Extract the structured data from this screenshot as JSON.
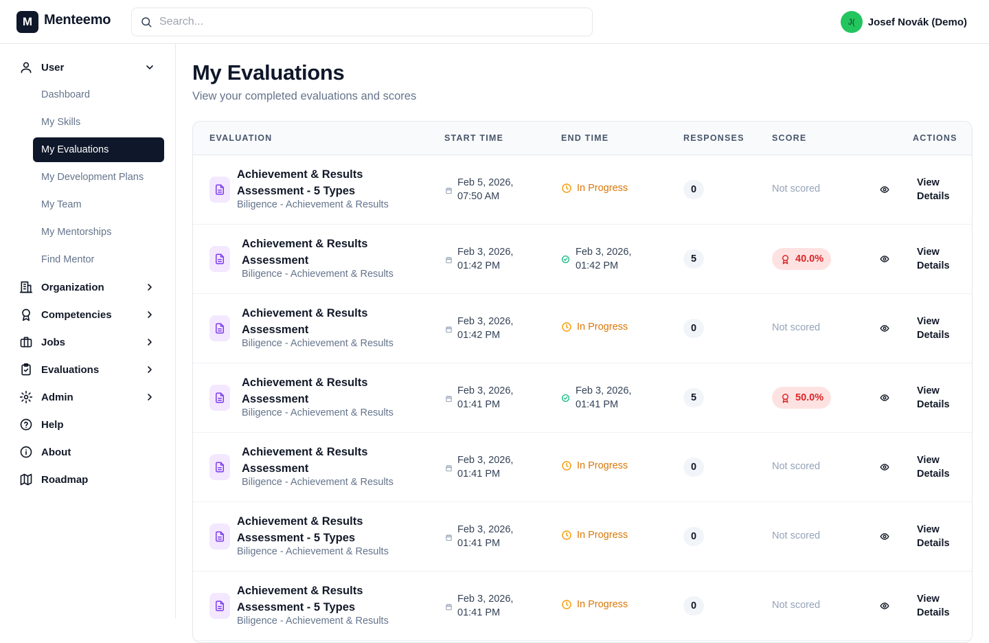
{
  "app": {
    "logo_letter": "M",
    "name": "Menteemo"
  },
  "search": {
    "placeholder": "Search..."
  },
  "user": {
    "initials": "J(",
    "name": "Josef Novák (Demo)"
  },
  "sidebar": {
    "user_group": "User",
    "user_items": [
      "Dashboard",
      "My Skills",
      "My Evaluations",
      "My Development Plans",
      "My Team",
      "My Mentorships",
      "Find Mentor"
    ],
    "active_item": "My Evaluations",
    "groups": [
      "Organization",
      "Competencies",
      "Jobs",
      "Evaluations",
      "Admin",
      "Help",
      "About",
      "Roadmap"
    ]
  },
  "page": {
    "title": "My Evaluations",
    "subtitle": "View your completed evaluations and scores"
  },
  "table": {
    "columns": [
      "EVALUATION",
      "START TIME",
      "END TIME",
      "RESPONSES",
      "SCORE",
      "ACTIONS"
    ],
    "in_progress_label": "In Progress",
    "not_scored_label": "Not scored",
    "action_label_1": "View",
    "action_label_2": "Details",
    "rows": [
      {
        "title_1": "Achievement & Results",
        "title_2": "Assessment - 5 Types",
        "subtitle": "Biligence - Achievement & Results",
        "start_1": "Feb 5, 2026,",
        "start_2": "07:50 AM",
        "end_1": "",
        "end_2": "",
        "responses": "0",
        "score": ""
      },
      {
        "title_1": "Achievement & Results",
        "title_2": "Assessment",
        "subtitle": "Biligence - Achievement & Results",
        "start_1": "Feb 3, 2026,",
        "start_2": "01:42 PM",
        "end_1": "Feb 3, 2026,",
        "end_2": "01:42 PM",
        "responses": "5",
        "score": "40.0%"
      },
      {
        "title_1": "Achievement & Results",
        "title_2": "Assessment",
        "subtitle": "Biligence - Achievement & Results",
        "start_1": "Feb 3, 2026,",
        "start_2": "01:42 PM",
        "end_1": "",
        "end_2": "",
        "responses": "0",
        "score": ""
      },
      {
        "title_1": "Achievement & Results",
        "title_2": "Assessment",
        "subtitle": "Biligence - Achievement & Results",
        "start_1": "Feb 3, 2026,",
        "start_2": "01:41 PM",
        "end_1": "Feb 3, 2026,",
        "end_2": "01:41 PM",
        "responses": "5",
        "score": "50.0%"
      },
      {
        "title_1": "Achievement & Results",
        "title_2": "Assessment",
        "subtitle": "Biligence - Achievement & Results",
        "start_1": "Feb 3, 2026,",
        "start_2": "01:41 PM",
        "end_1": "",
        "end_2": "",
        "responses": "0",
        "score": ""
      },
      {
        "title_1": "Achievement & Results",
        "title_2": "Assessment - 5 Types",
        "subtitle": "Biligence - Achievement & Results",
        "start_1": "Feb 3, 2026,",
        "start_2": "01:41 PM",
        "end_1": "",
        "end_2": "",
        "responses": "0",
        "score": ""
      },
      {
        "title_1": "Achievement & Results",
        "title_2": "Assessment - 5 Types",
        "subtitle": "Biligence - Achievement & Results",
        "start_1": "Feb 3, 2026,",
        "start_2": "01:41 PM",
        "end_1": "",
        "end_2": "",
        "responses": "0",
        "score": ""
      }
    ]
  },
  "colors": {
    "brand": "#0f172a",
    "accent_purple": "#7c3aed",
    "in_progress": "#d97706",
    "completed": "#10b981",
    "score_bg": "#fee2e2",
    "score_text": "#dc2626"
  }
}
